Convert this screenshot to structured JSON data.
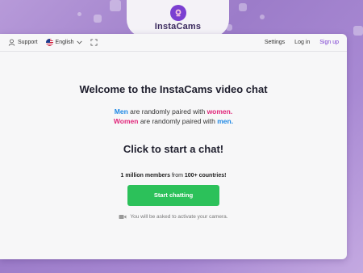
{
  "brand": {
    "name": "InstaCams"
  },
  "topbar": {
    "support_label": "Support",
    "language_label": "English",
    "settings_label": "Settings",
    "login_label": "Log in",
    "signup_label": "Sign up"
  },
  "main": {
    "title": "Welcome to the InstaCams video chat",
    "line1": {
      "a": "Men",
      "b": " are randomly paired with ",
      "c": "women."
    },
    "line2": {
      "a": "Women",
      "b": " are randomly paired with ",
      "c": "men."
    },
    "cta": "Click to start a chat!",
    "members": {
      "count": "1 million members",
      "mid": " from ",
      "countries": "100+ countries!"
    },
    "start_button": "Start chatting",
    "camera_note": "You will be asked to activate your camera."
  },
  "colors": {
    "men": "#1e88e5",
    "women": "#e0267a",
    "button": "#2cc15a",
    "brand": "#7b3fd1"
  }
}
